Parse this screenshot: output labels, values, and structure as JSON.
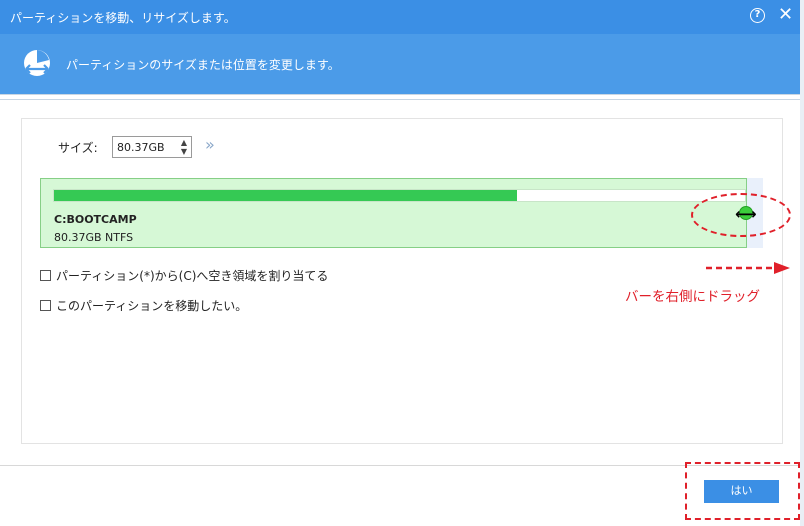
{
  "window": {
    "title": "パーティションを移動、リサイズします。",
    "help_glyph": "?",
    "close_glyph": "✕"
  },
  "banner": {
    "icon": "partition-move-icon",
    "text": "パーティションのサイズまたは位置を変更します。"
  },
  "size": {
    "label": "サイズ:",
    "value": "80.37GB",
    "expand_glyph": "»"
  },
  "partition": {
    "name": "C:BOOTCAMP",
    "detail": "80.37GB NTFS",
    "used_fraction": 0.67
  },
  "options": [
    {
      "label": "パーティション(*)から(C)へ空き領域を割り当てる",
      "checked": false
    },
    {
      "label": "このパーティションを移動したい。",
      "checked": false
    }
  ],
  "annotation": {
    "text": "バーを右側にドラッグ",
    "color": "#e0202a"
  },
  "footer": {
    "ok_label": "はい"
  },
  "colors": {
    "titlebar": "#3b8fe5",
    "banner": "#4b9be8",
    "partition_bg": "#d6f8d6",
    "partition_fill": "#35c954"
  }
}
